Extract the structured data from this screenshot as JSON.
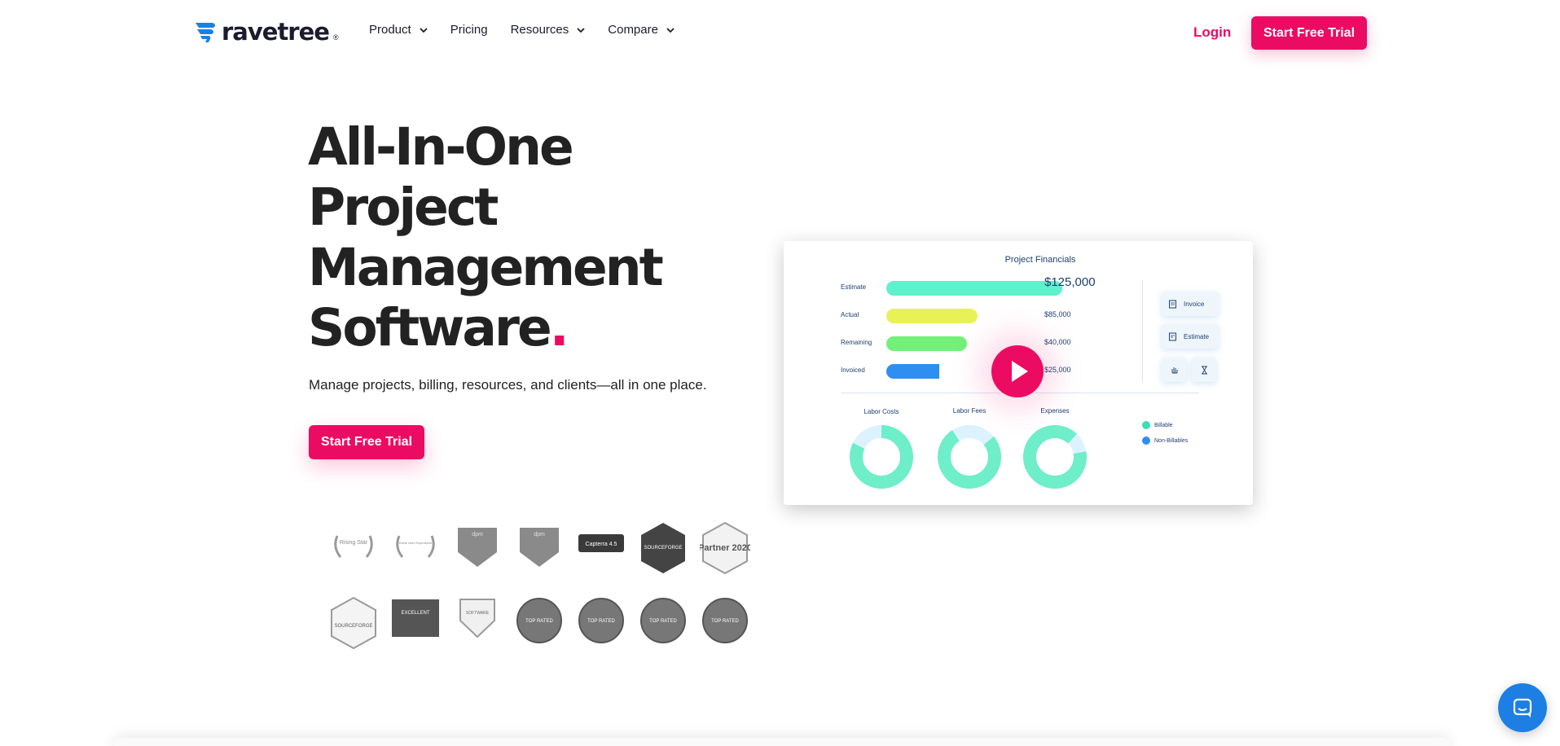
{
  "brand": {
    "name": "ravetree",
    "reg": "®"
  },
  "nav": {
    "items": [
      {
        "label": "Product",
        "dropdown": true
      },
      {
        "label": "Pricing",
        "dropdown": false
      },
      {
        "label": "Resources",
        "dropdown": true
      },
      {
        "label": "Compare",
        "dropdown": true
      }
    ],
    "login": "Login",
    "cta": "Start Free Trial"
  },
  "hero": {
    "title_lines": [
      "All-In-One",
      "Project",
      "Management",
      "Software"
    ],
    "title_dot": ".",
    "subtitle": "Manage projects, billing, resources, and clients—all in one place.",
    "cta": "Start Free Trial"
  },
  "badges": {
    "row1": [
      "Rising Star",
      "Great User Experience",
      "dpm",
      "dpm",
      "Capterra 4.5",
      "SOURCEFORGE",
      "Partner 2020"
    ],
    "row2": [
      "SOURCEFORGE",
      "EXCELLENT",
      "SOFTWARE",
      "TOP RATED",
      "TOP RATED",
      "TOP RATED",
      "TOP RATED"
    ]
  },
  "video": {
    "title": "Project Financials",
    "rows": [
      {
        "label": "Estimate",
        "value": "$125,000",
        "fraction": 1.0,
        "color": "#5ff0cc"
      },
      {
        "label": "Actual",
        "value": "$85,000",
        "fraction": 0.52,
        "color": "#e8f256"
      },
      {
        "label": "Remaining",
        "value": "$40,000",
        "fraction": 0.46,
        "color": "#72f07a"
      },
      {
        "label": "Invoiced",
        "value": "$25,000",
        "fraction": 0.3,
        "color": "#2e8ff0"
      }
    ],
    "side_buttons": [
      "Invoice",
      "Estimate"
    ],
    "donuts": [
      {
        "label": "Labor Costs"
      },
      {
        "label": "Labor Fees"
      },
      {
        "label": "Expenses"
      }
    ],
    "legend": [
      {
        "label": "Billable",
        "color": "#38e0b4"
      },
      {
        "label": "Non-Billables",
        "color": "#2e8ff0"
      }
    ],
    "play_icon": "play-icon"
  },
  "colors": {
    "accent": "#ec0b62",
    "chat": "#1d7fe4",
    "text": "#222222"
  }
}
